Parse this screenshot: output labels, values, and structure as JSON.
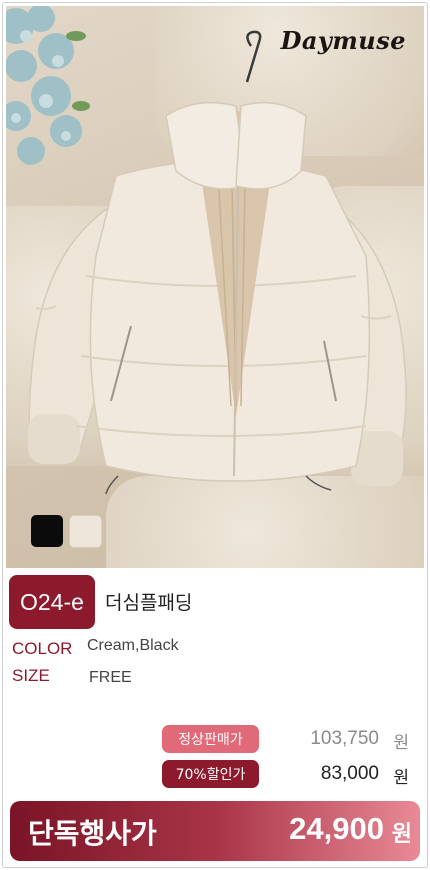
{
  "brand": {
    "logo_text": "Daymuse"
  },
  "colors": {
    "accent": "#8d1a2c",
    "pink": "#e06a78",
    "jacket": "#f1e9de"
  },
  "swatches": [
    {
      "name": "black",
      "color": "#0b0b0b"
    },
    {
      "name": "cream",
      "color": "#efe6da"
    }
  ],
  "product": {
    "code": "O24-e",
    "name": "더심플패딩",
    "color_label": "COLOR",
    "color_value": "Cream,Black",
    "size_label": "SIZE",
    "size_value": "FREE"
  },
  "pricing": {
    "regular_label": "정상판매가",
    "regular_price": "103,750",
    "discount_label": "70%할인가",
    "discount_price": "83,000",
    "currency": "원",
    "exclusive_label": "단독행사가",
    "exclusive_price": "24,900",
    "exclusive_currency": "원"
  }
}
